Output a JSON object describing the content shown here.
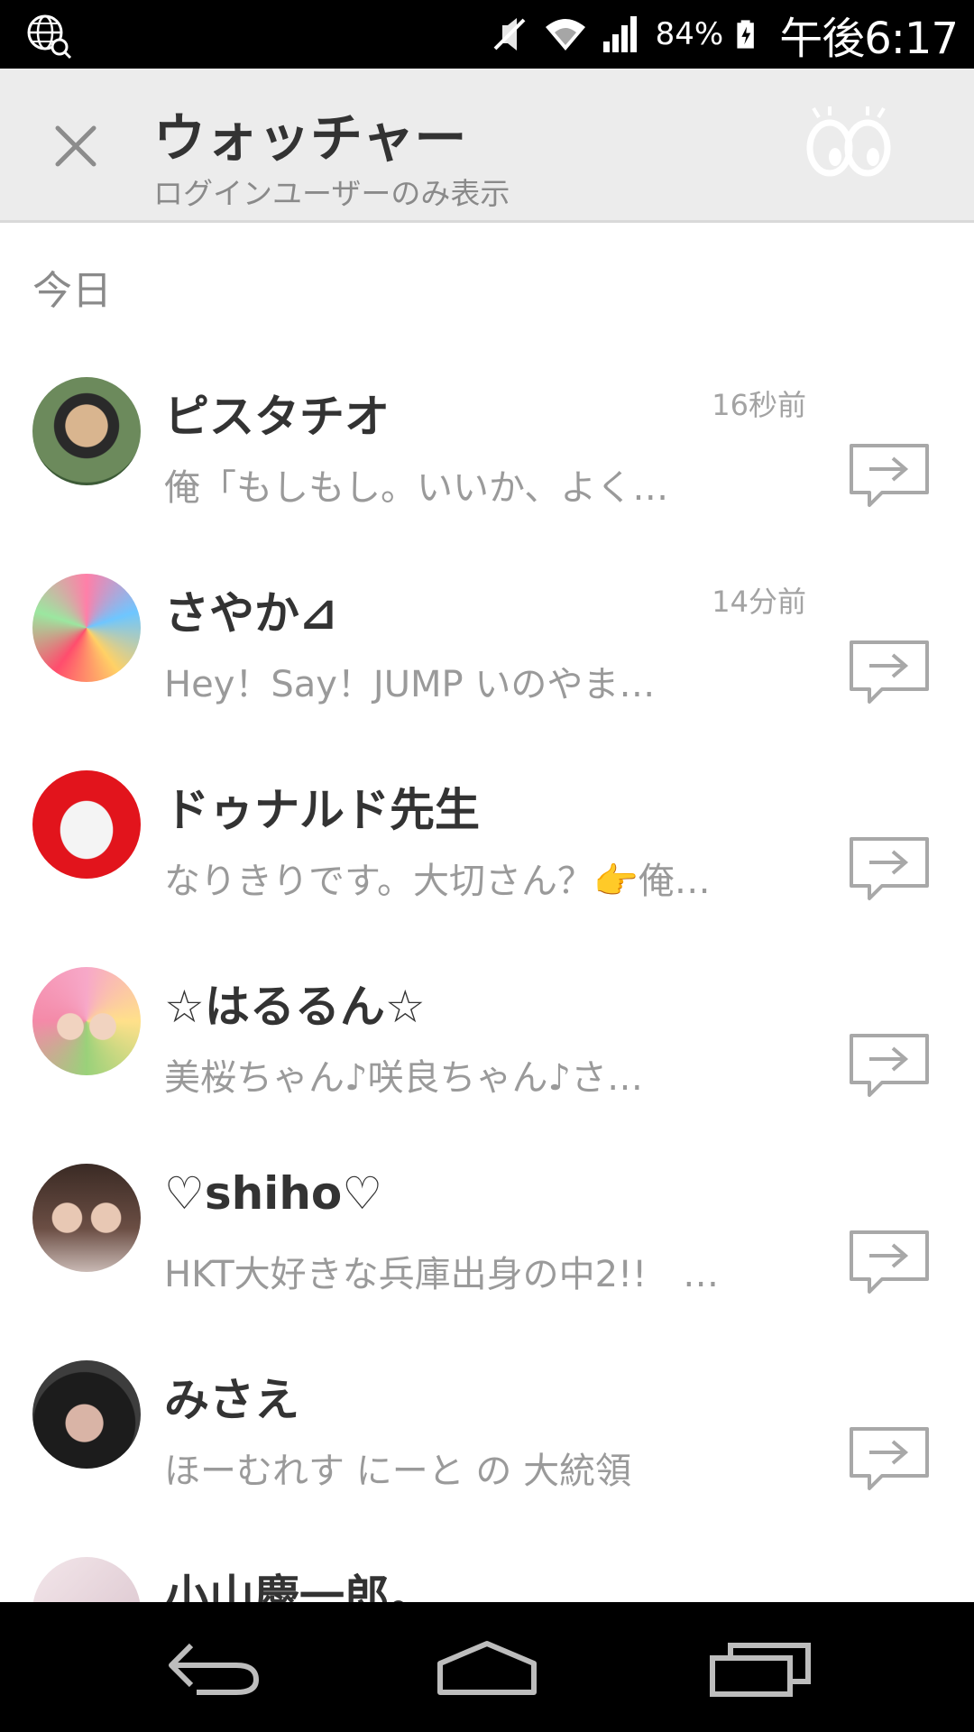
{
  "status_bar": {
    "left_icon": "globe-search-icon",
    "icons": [
      "mute-icon",
      "wifi-icon",
      "signal-icon",
      "battery-charging-icon"
    ],
    "battery_percent": "84%",
    "time": "午後6:17"
  },
  "header": {
    "close_icon": "close-icon",
    "title": "ウォッチャー",
    "subtitle": "ログインユーザーのみ表示",
    "watch_icon": "eyes-icon"
  },
  "section": {
    "label": "今日"
  },
  "users": [
    {
      "name": "ピスタチオ",
      "time": "16秒前",
      "message": "俺「もしもし。いいか、よく…"
    },
    {
      "name": "さやか⊿",
      "time": "14分前",
      "message": "Hey！Say！JUMP いのやま…"
    },
    {
      "name": "ドゥナルド先生",
      "time": "",
      "message": "なりきりです。大切さん？👉俺…"
    },
    {
      "name": "☆はるるん☆",
      "time": "",
      "message": "美桜ちゃん♪咲良ちゃん♪さ…"
    },
    {
      "name": "♡shiho♡",
      "time": "",
      "message": "HKT大好きな兵庫出身の中2!!　…"
    },
    {
      "name": "みさえ",
      "time": "",
      "message": "ほーむれす にーと の 大統領"
    },
    {
      "name": "小山慶一郎。",
      "time": "",
      "message": ""
    }
  ],
  "colors": {
    "status_bar": "#000000",
    "header_bg": "#ececec",
    "title": "#333333",
    "muted": "#9a9a9a",
    "icon_gray": "#a8a8a8"
  },
  "nav": {
    "back_icon": "back-icon",
    "home_icon": "home-icon",
    "recents_icon": "recents-icon"
  }
}
